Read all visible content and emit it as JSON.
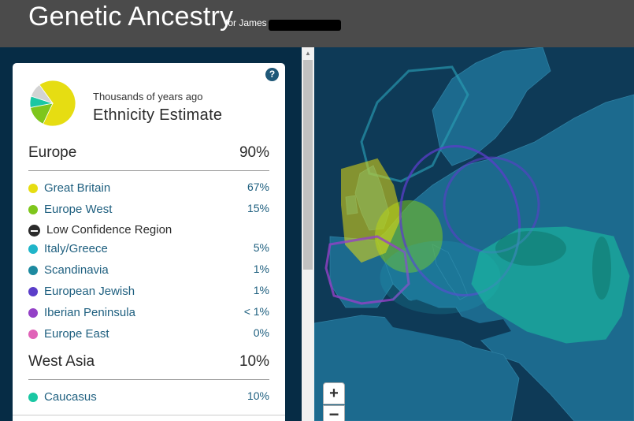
{
  "header": {
    "title": "Genetic Ancestry",
    "for_label": "for James"
  },
  "panel": {
    "subtitle": "Thousands of years ago",
    "heading": "Ethnicity Estimate",
    "help_glyph": "?"
  },
  "regions": [
    {
      "name": "Europe",
      "percent": "90%",
      "items": [
        {
          "label": "Great Britain",
          "value": "67%",
          "color": "#e6dd12"
        },
        {
          "label": "Europe West",
          "value": "15%",
          "color": "#7ec61c"
        },
        {
          "label": "Italy/Greece",
          "value": "5%",
          "color": "#20b5c9"
        },
        {
          "label": "Scandinavia",
          "value": "1%",
          "color": "#1d8aa0"
        },
        {
          "label": "European Jewish",
          "value": "1%",
          "color": "#5b3ec9"
        },
        {
          "label": "Iberian Peninsula",
          "value": "< 1%",
          "color": "#9441c7"
        },
        {
          "label": "Europe East",
          "value": "0%",
          "color": "#e063b8"
        }
      ]
    },
    {
      "name": "West Asia",
      "percent": "10%",
      "items": [
        {
          "label": "Caucasus",
          "value": "10%",
          "color": "#1ac7a3"
        }
      ]
    }
  ],
  "low_confidence_label": "Low Confidence Region",
  "pie": {
    "slices": [
      {
        "fraction": 0.67,
        "color": "#e6dd12"
      },
      {
        "fraction": 0.15,
        "color": "#7ec61c"
      },
      {
        "fraction": 0.08,
        "color": "#1ac7a3"
      },
      {
        "fraction": 0.1,
        "color": "#d3d3d3"
      }
    ]
  },
  "map": {
    "zoom_in": "+",
    "zoom_out": "−"
  }
}
